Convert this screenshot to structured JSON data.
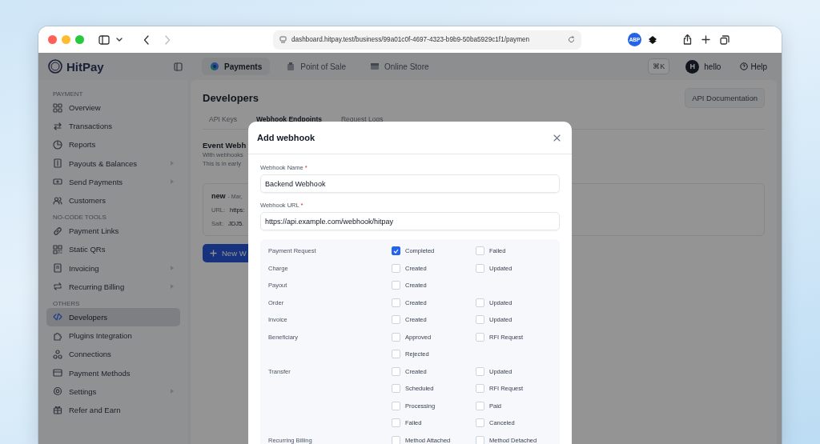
{
  "browser": {
    "address": "dashboard.hitpay.test/business/99a01c0f-4697-4323-b9b9-50ba5929c1f1/paymen",
    "extension_badge": "ABP"
  },
  "header": {
    "logo": "HitPay",
    "nav_tabs": [
      {
        "label": "Payments",
        "selected": true
      },
      {
        "label": "Point of Sale",
        "selected": false
      },
      {
        "label": "Online Store",
        "selected": false
      }
    ],
    "shortcut": "⌘K",
    "user": {
      "initial": "H",
      "name": "hello"
    },
    "help": "Help"
  },
  "sidebar": {
    "sections": [
      {
        "title": "PAYMENT",
        "items": [
          {
            "label": "Overview",
            "selected": false,
            "submenu": false
          },
          {
            "label": "Transactions",
            "selected": false,
            "submenu": false
          },
          {
            "label": "Reports",
            "selected": false,
            "submenu": false
          },
          {
            "label": "Payouts & Balances",
            "selected": false,
            "submenu": true
          },
          {
            "label": "Send Payments",
            "selected": false,
            "submenu": true
          },
          {
            "label": "Customers",
            "selected": false,
            "submenu": false
          }
        ]
      },
      {
        "title": "NO-CODE TOOLS",
        "items": [
          {
            "label": "Payment Links",
            "selected": false,
            "submenu": false
          },
          {
            "label": "Static QRs",
            "selected": false,
            "submenu": false
          },
          {
            "label": "Invoicing",
            "selected": false,
            "submenu": true
          },
          {
            "label": "Recurring Billing",
            "selected": false,
            "submenu": true
          }
        ]
      },
      {
        "title": "OTHERS",
        "items": [
          {
            "label": "Developers",
            "selected": true,
            "submenu": false
          },
          {
            "label": "Plugins Integration",
            "selected": false,
            "submenu": false
          },
          {
            "label": "Connections",
            "selected": false,
            "submenu": false
          },
          {
            "label": "Payment Methods",
            "selected": false,
            "submenu": false
          },
          {
            "label": "Settings",
            "selected": false,
            "submenu": true
          },
          {
            "label": "Refer and Earn",
            "selected": false,
            "submenu": false
          }
        ]
      }
    ]
  },
  "page": {
    "title": "Developers",
    "doc_button": "API Documentation",
    "tabs": [
      {
        "label": "API Keys",
        "selected": false
      },
      {
        "label": "Webhook Endpoints",
        "selected": true
      },
      {
        "label": "Request Logs",
        "selected": false
      }
    ],
    "section_title": "Event Webh",
    "lines": [
      "With webhooks",
      "This is in early"
    ],
    "endpoint": {
      "name": "new",
      "date": "- Mar,",
      "url_label": "URL:",
      "url": "https:",
      "salt_label": "Salt:",
      "salt": "JDJ5."
    },
    "new_button": "New W"
  },
  "modal": {
    "title": "Add webhook",
    "fields": [
      {
        "label": "Webhook Name",
        "required_mark": "*",
        "value": "Backend Webhook"
      },
      {
        "label": "Webhook URL",
        "required_mark": "*",
        "value": "https://api.example.com/webhook/hitpay"
      }
    ],
    "events": [
      {
        "label": "Payment Request",
        "options": [
          {
            "label": "Completed",
            "checked": true
          },
          {
            "label": "Failed",
            "checked": false
          }
        ]
      },
      {
        "label": "Charge",
        "options": [
          {
            "label": "Created",
            "checked": false
          },
          {
            "label": "Updated",
            "checked": false
          }
        ]
      },
      {
        "label": "Payout",
        "options": [
          {
            "label": "Created",
            "checked": false
          }
        ]
      },
      {
        "label": "Order",
        "options": [
          {
            "label": "Created",
            "checked": false
          },
          {
            "label": "Updated",
            "checked": false
          }
        ]
      },
      {
        "label": "Invoice",
        "options": [
          {
            "label": "Created",
            "checked": false
          },
          {
            "label": "Updated",
            "checked": false
          }
        ]
      },
      {
        "label": "Beneficiary",
        "options": [
          {
            "label": "Approved",
            "checked": false
          },
          {
            "label": "RFI Request",
            "checked": false
          },
          {
            "label": "Rejected",
            "checked": false
          }
        ]
      },
      {
        "label": "Transfer",
        "options": [
          {
            "label": "Created",
            "checked": false
          },
          {
            "label": "Updated",
            "checked": false
          },
          {
            "label": "Scheduled",
            "checked": false
          },
          {
            "label": "RFI Request",
            "checked": false
          },
          {
            "label": "Processing",
            "checked": false
          },
          {
            "label": "Paid",
            "checked": false
          },
          {
            "label": "Failed",
            "checked": false
          },
          {
            "label": "Canceled",
            "checked": false
          }
        ]
      },
      {
        "label": "Recurring Billing",
        "options": [
          {
            "label": "Method Attached",
            "checked": false
          },
          {
            "label": "Method Detached",
            "checked": false
          }
        ]
      }
    ]
  }
}
